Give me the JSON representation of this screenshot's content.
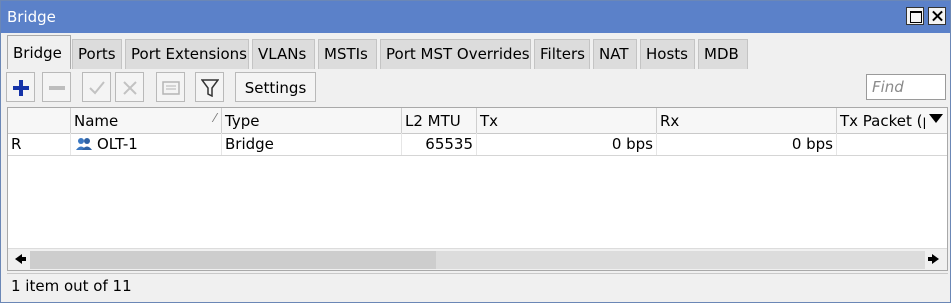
{
  "window": {
    "title": "Bridge"
  },
  "tabs": [
    "Bridge",
    "Ports",
    "Port Extensions",
    "VLANs",
    "MSTIs",
    "Port MST Overrides",
    "Filters",
    "NAT",
    "Hosts",
    "MDB"
  ],
  "active_tab": "Bridge",
  "toolbar": {
    "icons": [
      "add-icon",
      "remove-icon",
      "enable-icon",
      "disable-icon",
      "comment-icon",
      "filter-icon"
    ],
    "settings_label": "Settings",
    "find_placeholder": "Find"
  },
  "table": {
    "columns": [
      "",
      "Name",
      "Type",
      "L2 MTU",
      "Tx",
      "Rx",
      "Tx Packet (p"
    ],
    "rows": [
      {
        "flag": "R",
        "name": "OLT-1",
        "type": "Bridge",
        "l2mtu": "65535",
        "tx": "0 bps",
        "rx": "0 bps",
        "tx_packet": ""
      }
    ]
  },
  "status": {
    "text": "1 item out of 11"
  },
  "colors": {
    "titlebar": "#5b81c9",
    "add_icon": "#1533a8",
    "user_icon": "#3b78c2"
  }
}
